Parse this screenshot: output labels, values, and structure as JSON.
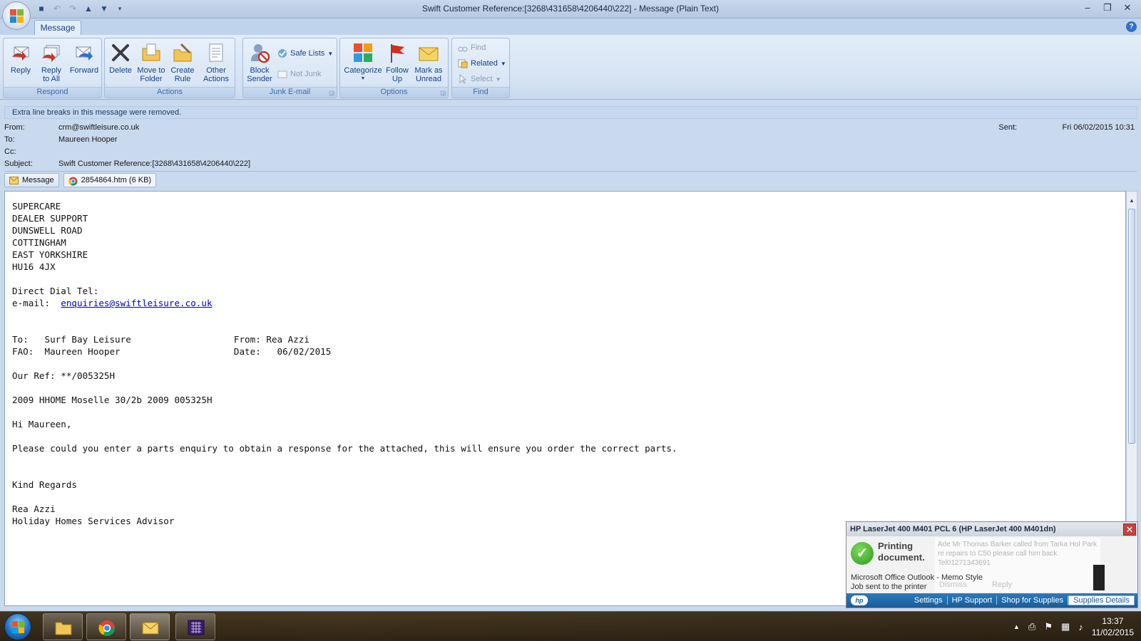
{
  "window": {
    "title": "Swift Customer Reference:[3268\\431658\\4206440\\222] - Message (Plain Text)"
  },
  "ribbon": {
    "tab": "Message",
    "groups": {
      "respond": {
        "label": "Respond",
        "reply": "Reply",
        "reply_all": "Reply\nto All",
        "forward": "Forward"
      },
      "actions": {
        "label": "Actions",
        "delete": "Delete",
        "move_to_folder": "Move to\nFolder",
        "create_rule": "Create\nRule",
        "other_actions": "Other\nActions"
      },
      "junk": {
        "label": "Junk E-mail",
        "block_sender": "Block\nSender",
        "safe_lists": "Safe Lists",
        "not_junk": "Not Junk"
      },
      "options": {
        "label": "Options",
        "categorize": "Categorize",
        "follow_up": "Follow\nUp",
        "mark_unread": "Mark as\nUnread"
      },
      "find": {
        "label": "Find",
        "find": "Find",
        "related": "Related",
        "select": "Select"
      }
    }
  },
  "infobar": "Extra line breaks in this message were removed.",
  "header": {
    "from_label": "From:",
    "from": "crm@swiftleisure.co.uk",
    "to_label": "To:",
    "to": "Maureen Hooper",
    "cc_label": "Cc:",
    "cc": "",
    "subject_label": "Subject:",
    "subject": "Swift Customer Reference:[3268\\431658\\4206440\\222]",
    "sent_label": "Sent:",
    "sent": "Fri 06/02/2015 10:31"
  },
  "attachments": {
    "message": "Message",
    "file": "2854864.htm (6 KB)"
  },
  "body": {
    "block1": "SUPERCARE\nDEALER SUPPORT\nDUNSWELL ROAD\nCOTTINGHAM\nEAST YORKSHIRE\nHU16 4JX\n\nDirect Dial Tel:",
    "email_prefix": "e-mail:  ",
    "email_link": "enquiries@swiftleisure.co.uk",
    "block2": "\n\n\nTo:   Surf Bay Leisure                   From: Rea Azzi\nFAO:  Maureen Hooper                     Date:   06/02/2015\n\nOur Ref: **/005325H\n\n2009 HHOME Moselle 30/2b 2009 005325H\n\nHi Maureen,\n\nPlease could you enter a parts enquiry to obtain a response for the attached, this will ensure you order the correct parts.\n\n\nKind Regards\n\nRea Azzi\nHoliday Homes Services Advisor"
  },
  "printer_popup": {
    "title": "HP LaserJet 400 M401 PCL 6 (HP LaserJet 400 M401dn)",
    "status": "Printing\ndocument.",
    "line1": "Microsoft Office Outlook - Memo Style",
    "line2": "Job sent to the printer",
    "ghost_text": "Ade Mr Thomas Barker called  from Tarka Hol Park\nre repairs to C50 please call him back\nTel01271343691",
    "ghost_dismiss": "Dismiss",
    "ghost_reply": "Reply",
    "links": [
      "Settings",
      "HP Support",
      "Shop for Supplies",
      "Supplies Details"
    ],
    "hp_logo": "hp"
  },
  "taskbar": {
    "time": "13:37",
    "date": "11/02/2015"
  }
}
